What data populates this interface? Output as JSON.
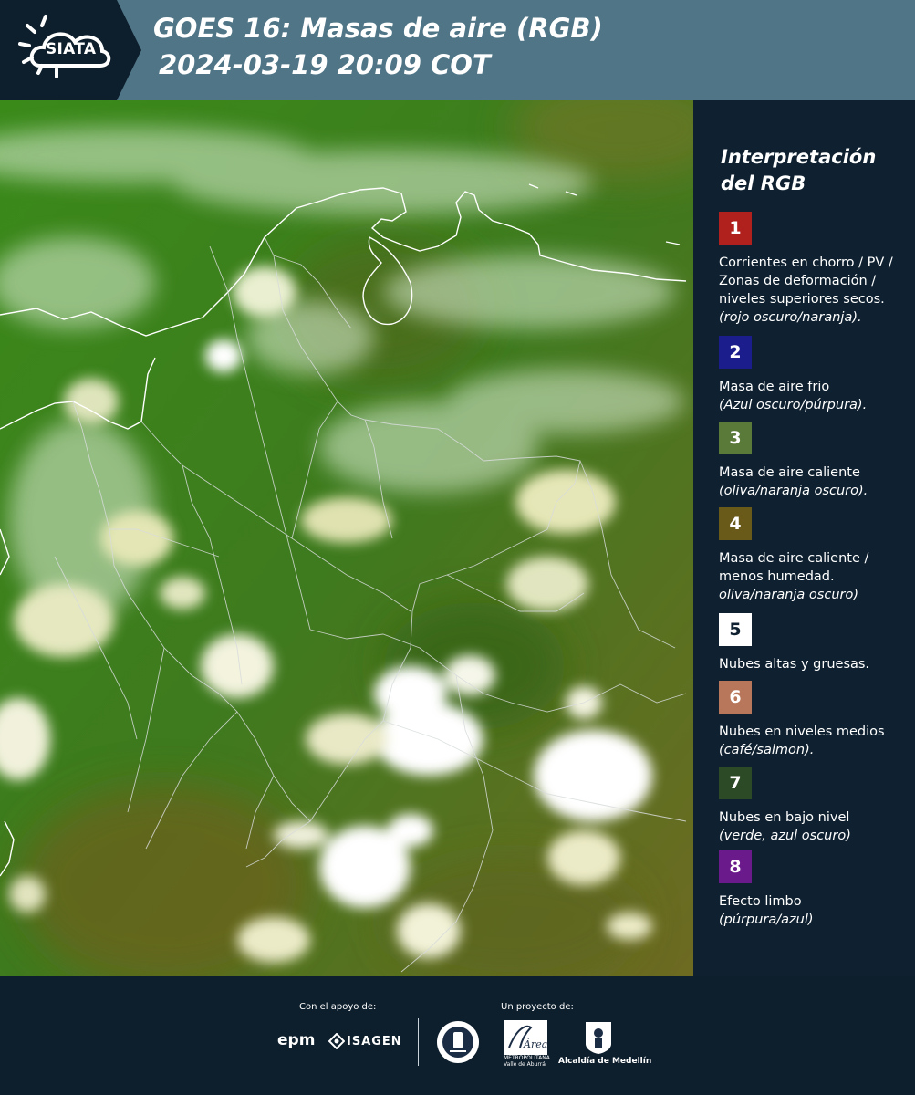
{
  "header": {
    "logo_text": "SIATA",
    "title_line1": "GOES 16: Masas de aire (RGB)",
    "title_line2": "2024-03-19 20:09 COT"
  },
  "legend": {
    "title_line1": "Interpretación",
    "title_line2": "del RGB",
    "items": [
      {
        "number": "1",
        "color": "#b0211e",
        "description": "Corrientes en chorro / PV / Zonas de deformación / niveles superiores secos.",
        "note": "(rojo oscuro/naranja)."
      },
      {
        "number": "2",
        "color": "#1b1d8c",
        "description": "Masa de aire frio",
        "note": "(Azul oscuro/púrpura)."
      },
      {
        "number": "3",
        "color": "#5a7a3a",
        "description": "Masa de aire caliente",
        "note": "(oliva/naranja oscuro)."
      },
      {
        "number": "4",
        "color": "#6a5a1a",
        "description": "Masa de aire caliente / menos humedad.",
        "note": "oliva/naranja oscuro)"
      },
      {
        "number": "5",
        "color": "#ffffff",
        "description": "Nubes altas y gruesas.",
        "note": ""
      },
      {
        "number": "6",
        "color": "#b8775a",
        "description": "Nubes en niveles medios",
        "note": "(café/salmon)."
      },
      {
        "number": "7",
        "color": "#2c4a26",
        "description": "Nubes en bajo nivel",
        "note": "(verde, azul oscuro)"
      },
      {
        "number": "8",
        "color": "#6a1a8a",
        "description": "Efecto limbo",
        "note": "(púrpura/azul)"
      }
    ]
  },
  "footer": {
    "support_label": "Con el apoyo de:",
    "project_label": "Un proyecto de:",
    "sponsor1": "epm",
    "sponsor2": "ISAGEN",
    "area_name": "Área",
    "area_subtitle1": "METROPOLITANA",
    "area_subtitle2": "Valle de Aburrá",
    "alcaldia": "Alcaldía de Medellín"
  }
}
